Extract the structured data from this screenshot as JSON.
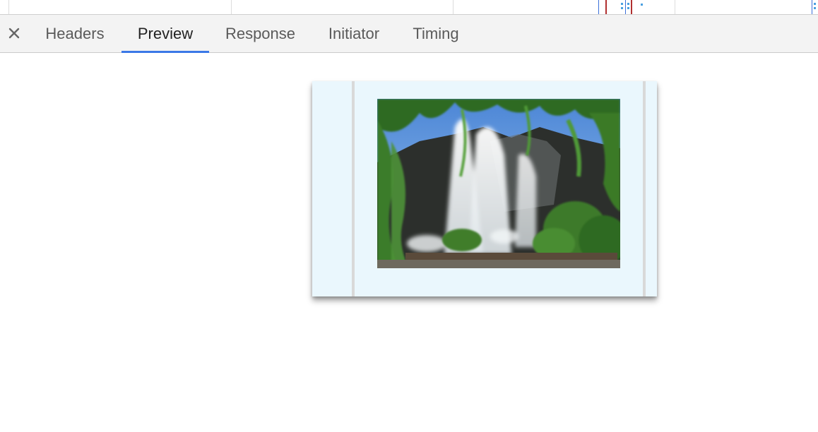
{
  "tab_bar": {
    "close_icon": "close-icon",
    "tabs": [
      {
        "label": "Headers",
        "active": false
      },
      {
        "label": "Preview",
        "active": true
      },
      {
        "label": "Response",
        "active": false
      },
      {
        "label": "Initiator",
        "active": false
      },
      {
        "label": "Timing",
        "active": false
      }
    ]
  },
  "preview": {
    "image_subject": "fountain-photo"
  },
  "colors": {
    "active_tab_underline": "#3b78e7",
    "tab_bar_bg": "#f3f3f3",
    "preview_bg": "#eaf7fd"
  }
}
